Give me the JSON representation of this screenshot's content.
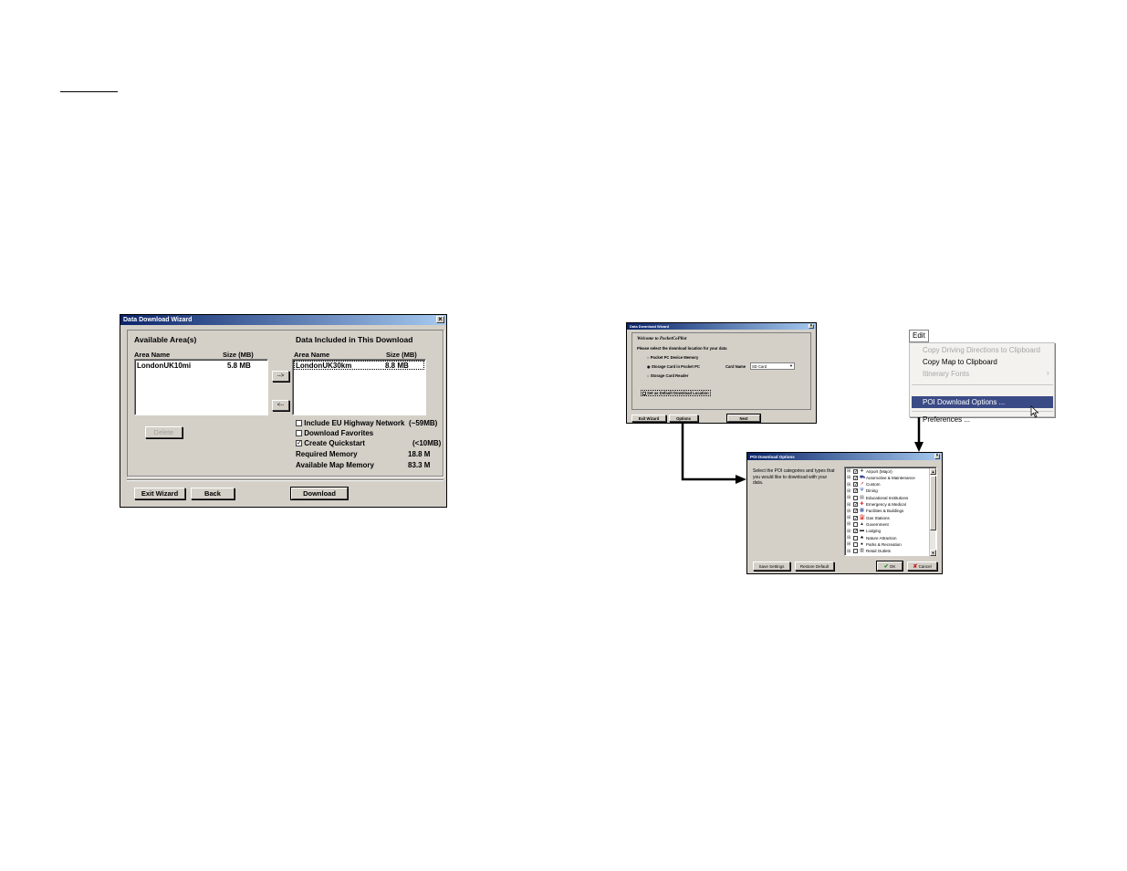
{
  "wizard1": {
    "title": "Data Download Wizard",
    "close": "×",
    "available_header": "Available Area(s)",
    "included_header": "Data Included in This Download",
    "col_area": "Area Name",
    "col_size": "Size (MB)",
    "available_rows": [
      {
        "name": "LondonUK10mi",
        "size": "5.8 MB"
      }
    ],
    "included_rows": [
      {
        "name": "LondonUK30km",
        "size": "8.8 MB"
      }
    ],
    "add_button": "-->",
    "remove_button": "<--",
    "delete_button": "Delete",
    "options": [
      {
        "label": "Include EU Highway Network",
        "extra": "(~59MB)",
        "checked": false
      },
      {
        "label": "Download Favorites",
        "extra": "",
        "checked": false
      },
      {
        "label": "Create Quickstart",
        "extra": "(<10MB)",
        "checked": true
      }
    ],
    "required_label": "Required Memory",
    "required_value": "18.8 M",
    "available_label": "Available Map Memory",
    "available_value": "83.3 M",
    "exit_button": "Exit Wizard",
    "back_button": "Back",
    "download_button": "Download"
  },
  "wizard2": {
    "title": "Data Download Wizard",
    "close": "×",
    "welcome": "Welcome to PocketCoPilot",
    "prompt": "Please select the download location for your data",
    "radio_options": [
      {
        "label": "Pocket PC Device Memory",
        "selected": false
      },
      {
        "label": "Storage Card in Pocket PC",
        "selected": true
      },
      {
        "label": "Storage Card Reader",
        "selected": false
      }
    ],
    "card_name_label": "Card Name",
    "card_name_value": "SD Card",
    "default_location": "Set as Default Download Location",
    "default_checked": true,
    "exit_button": "Exit Wizard",
    "options_button": "Options",
    "next_button": "Next"
  },
  "edit_menu": {
    "menu_title": "Edit",
    "items": [
      {
        "label": "Copy Driving Directions to Clipboard",
        "disabled": true
      },
      {
        "label": "Copy Map to Clipboard",
        "disabled": false
      },
      {
        "label": "Itinerary Fonts",
        "disabled": true,
        "submenu": "›"
      },
      {
        "label": "POI Download Options ...",
        "disabled": false,
        "selected": true
      },
      {
        "label": "Preferences ...",
        "disabled": false
      }
    ]
  },
  "poi": {
    "title": "POI Download Options",
    "close": "×",
    "instructions": "Select the POI categories and types that you would like to download with your data.",
    "categories": [
      {
        "label": "Airport (Major)",
        "checked": true,
        "icon": "airplane-icon",
        "color": "#000000"
      },
      {
        "label": "Automotive & Maintenance",
        "checked": true,
        "icon": "car-icon",
        "color": "#2b3a8c"
      },
      {
        "label": "Custom",
        "checked": true,
        "icon": "pin-icon",
        "color": "#c0282d"
      },
      {
        "label": "Dining",
        "checked": true,
        "icon": "fork-icon",
        "color": "#2b4fb0"
      },
      {
        "label": "Educational Institutions",
        "checked": false,
        "icon": "school-icon",
        "color": "#555555"
      },
      {
        "label": "Emergency & Medical",
        "checked": true,
        "icon": "cross-icon",
        "color": "#d42020"
      },
      {
        "label": "Facilities & Buildings",
        "checked": true,
        "icon": "building-icon",
        "color": "#1f3f8f"
      },
      {
        "label": "Gas Stations",
        "checked": true,
        "icon": "gas-icon",
        "color": "#2b4fb0"
      },
      {
        "label": "Government",
        "checked": false,
        "icon": "capitol-icon",
        "color": "#333333"
      },
      {
        "label": "Lodging",
        "checked": true,
        "icon": "bed-icon",
        "color": "#1a1a1a"
      },
      {
        "label": "Nature Attraction",
        "checked": false,
        "icon": "tree-icon",
        "color": "#1a1a1a"
      },
      {
        "label": "Parks & Recreation",
        "checked": false,
        "icon": "park-icon",
        "color": "#1a1a1a"
      },
      {
        "label": "Retail Outlets",
        "checked": false,
        "icon": "store-icon",
        "color": "#333333"
      }
    ],
    "save_button": "Save Settings",
    "restore_button": "Restore Default",
    "ok_button": "OK",
    "cancel_button": "Cancel"
  }
}
